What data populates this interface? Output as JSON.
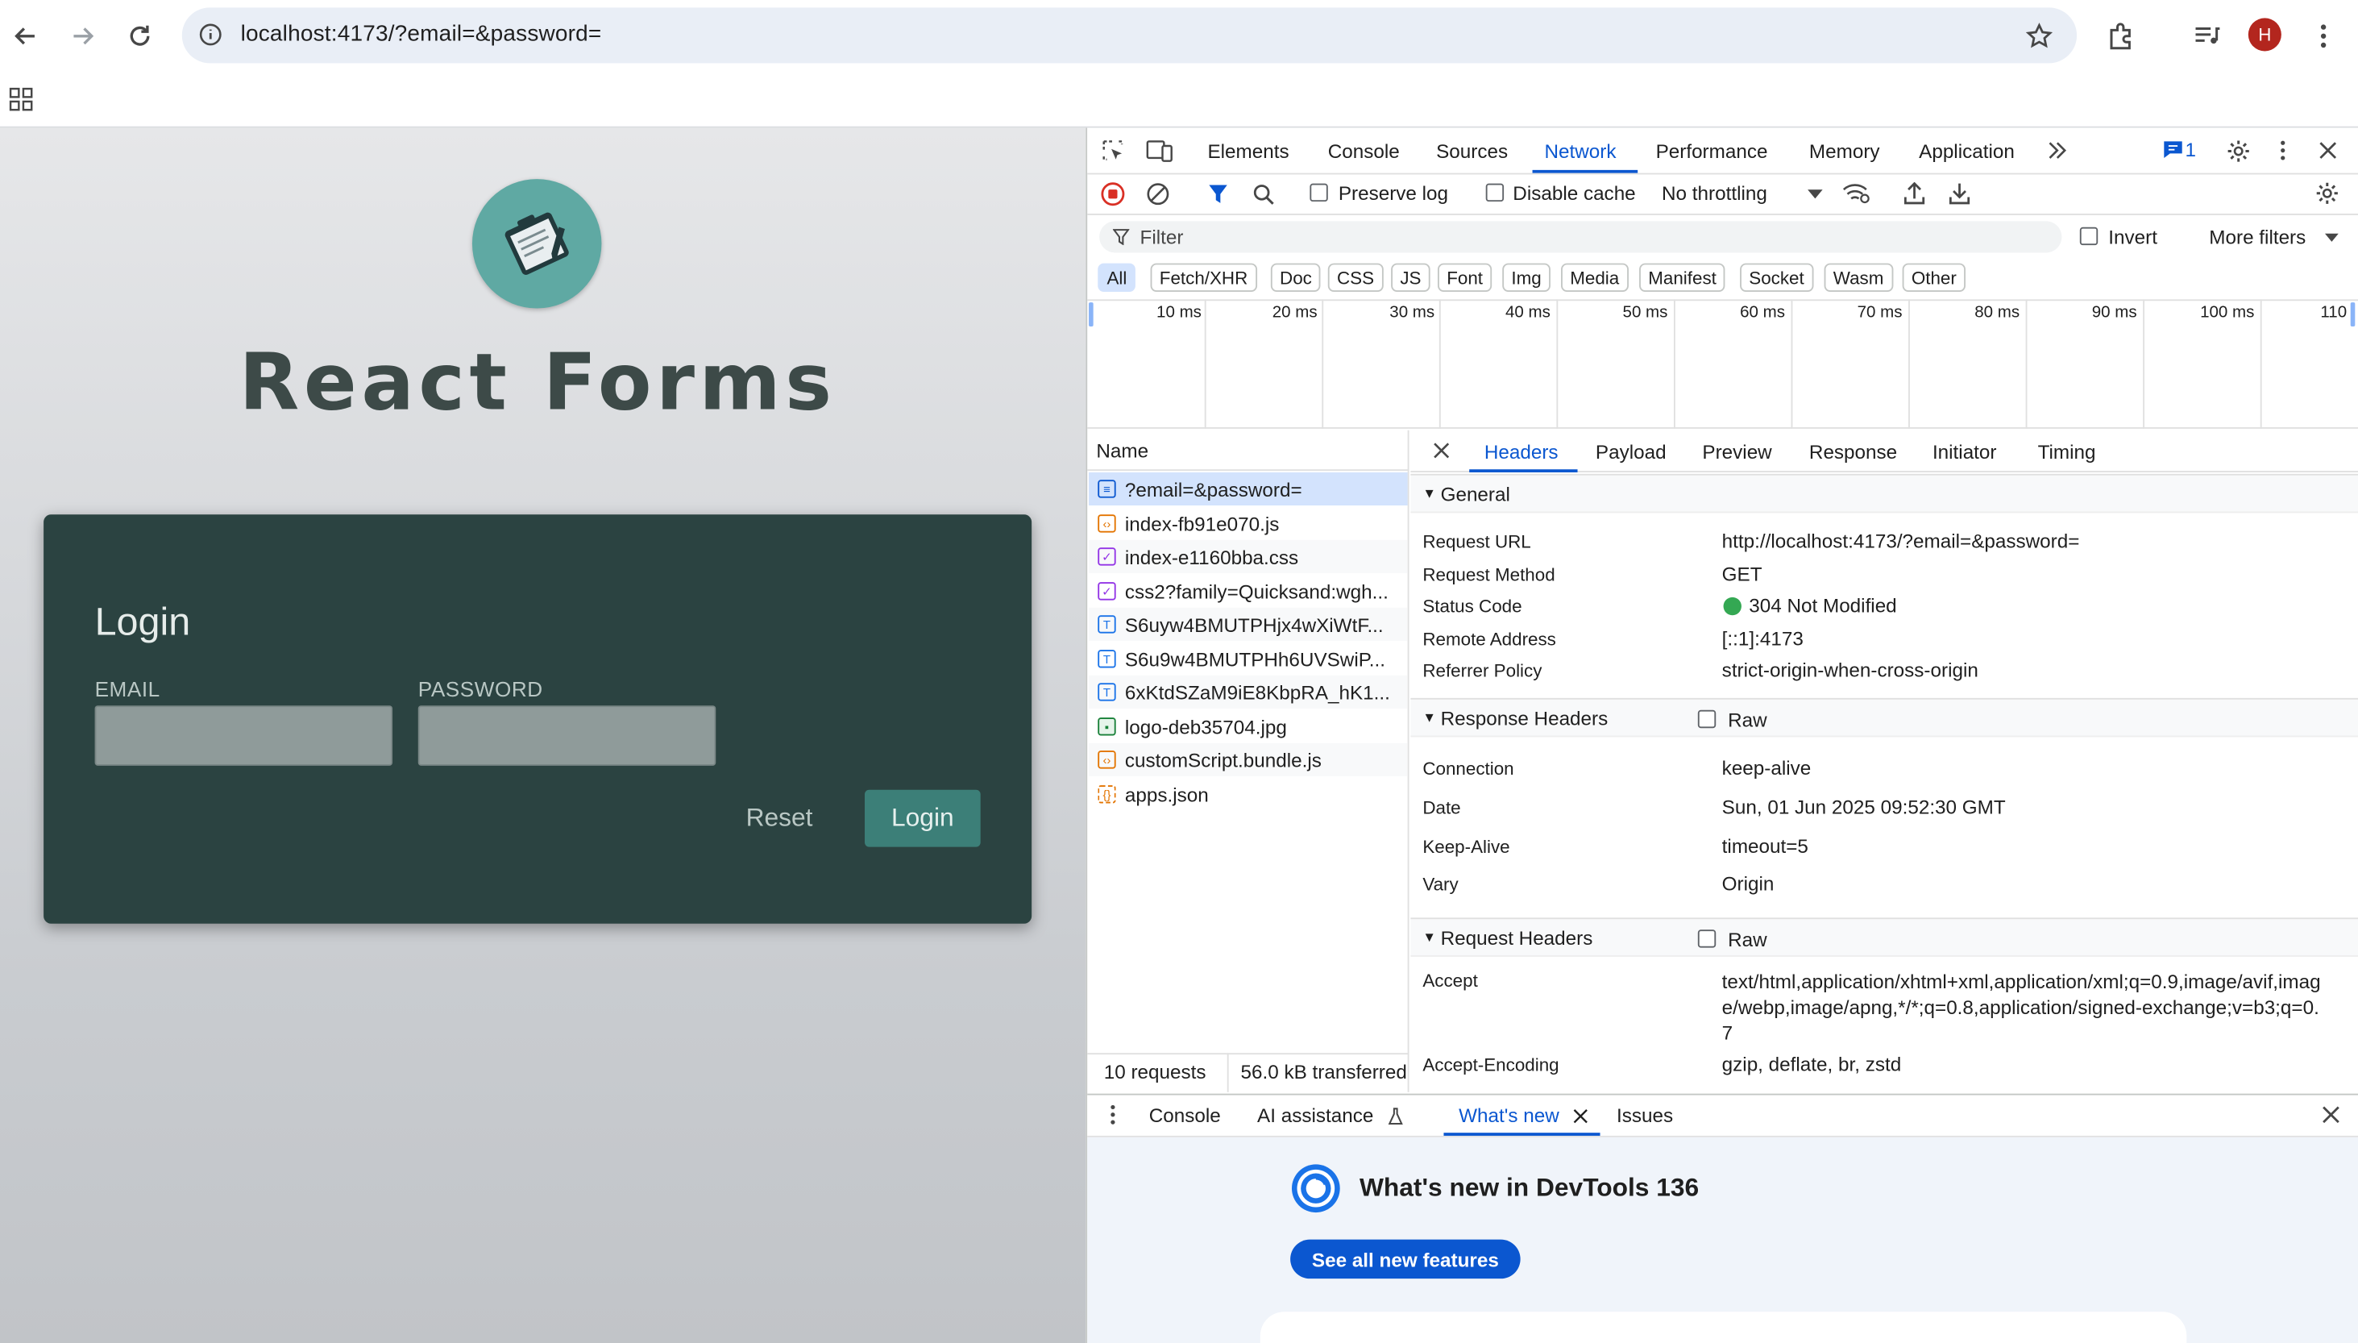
{
  "browser": {
    "url": "localhost:4173/?email=&password=",
    "avatar_letter": "H"
  },
  "page": {
    "title": "React Forms",
    "login_heading": "Login",
    "email_label": "EMAIL",
    "password_label": "PASSWORD",
    "reset_label": "Reset",
    "login_button": "Login"
  },
  "devtools": {
    "tabs": [
      "Elements",
      "Console",
      "Sources",
      "Network",
      "Performance",
      "Memory",
      "Application"
    ],
    "issues_count": "1",
    "toolbar": {
      "preserve_log": "Preserve log",
      "disable_cache": "Disable cache",
      "throttling": "No throttling"
    },
    "filter": {
      "placeholder": "Filter",
      "invert": "Invert",
      "more_filters": "More filters"
    },
    "type_filters": [
      "All",
      "Fetch/XHR",
      "Doc",
      "CSS",
      "JS",
      "Font",
      "Img",
      "Media",
      "Manifest",
      "Socket",
      "Wasm",
      "Other"
    ],
    "timeline_ticks": [
      "10 ms",
      "20 ms",
      "30 ms",
      "40 ms",
      "50 ms",
      "60 ms",
      "70 ms",
      "80 ms",
      "90 ms",
      "100 ms",
      "110"
    ],
    "name_header": "Name",
    "requests": [
      {
        "name": "?email=&password=",
        "kind": "doc"
      },
      {
        "name": "index-fb91e070.js",
        "kind": "js"
      },
      {
        "name": "index-e1160bba.css",
        "kind": "css"
      },
      {
        "name": "css2?family=Quicksand:wgh...",
        "kind": "css"
      },
      {
        "name": "S6uyw4BMUTPHjx4wXiWtF...",
        "kind": "font"
      },
      {
        "name": "S6u9w4BMUTPHh6UVSwiP...",
        "kind": "font"
      },
      {
        "name": "6xKtdSZaM9iE8KbpRA_hK1...",
        "kind": "font"
      },
      {
        "name": "logo-deb35704.jpg",
        "kind": "img"
      },
      {
        "name": "customScript.bundle.js",
        "kind": "js"
      },
      {
        "name": "apps.json",
        "kind": "json"
      }
    ],
    "status": {
      "requests": "10 requests",
      "transferred": "56.0 kB transferred"
    },
    "detail_tabs": [
      "Headers",
      "Payload",
      "Preview",
      "Response",
      "Initiator",
      "Timing"
    ],
    "general": {
      "title": "General",
      "rows": [
        {
          "k": "Request URL",
          "v": "http://localhost:4173/?email=&password="
        },
        {
          "k": "Request Method",
          "v": "GET"
        },
        {
          "k": "Status Code",
          "v": "304 Not Modified"
        },
        {
          "k": "Remote Address",
          "v": "[::1]:4173"
        },
        {
          "k": "Referrer Policy",
          "v": "strict-origin-when-cross-origin"
        }
      ]
    },
    "response_headers": {
      "title": "Response Headers",
      "raw": "Raw",
      "rows": [
        {
          "k": "Connection",
          "v": "keep-alive"
        },
        {
          "k": "Date",
          "v": "Sun, 01 Jun 2025 09:52:30 GMT"
        },
        {
          "k": "Keep-Alive",
          "v": "timeout=5"
        },
        {
          "k": "Vary",
          "v": "Origin"
        }
      ]
    },
    "request_headers": {
      "title": "Request Headers",
      "raw": "Raw",
      "accept_key": "Accept",
      "accept_value": "text/html,application/xhtml+xml,application/xml;q=0.9,image/avif,image/webp,image/apng,*/*;q=0.8,application/signed-exchange;v=b3;q=0.7",
      "encoding_key": "Accept-Encoding",
      "encoding_value": "gzip, deflate, br, zstd"
    },
    "drawer": {
      "tabs": [
        "Console",
        "AI assistance",
        "What's new",
        "Issues"
      ],
      "whats_new_title": "What's new in DevTools 136",
      "see_all": "See all new features"
    }
  }
}
